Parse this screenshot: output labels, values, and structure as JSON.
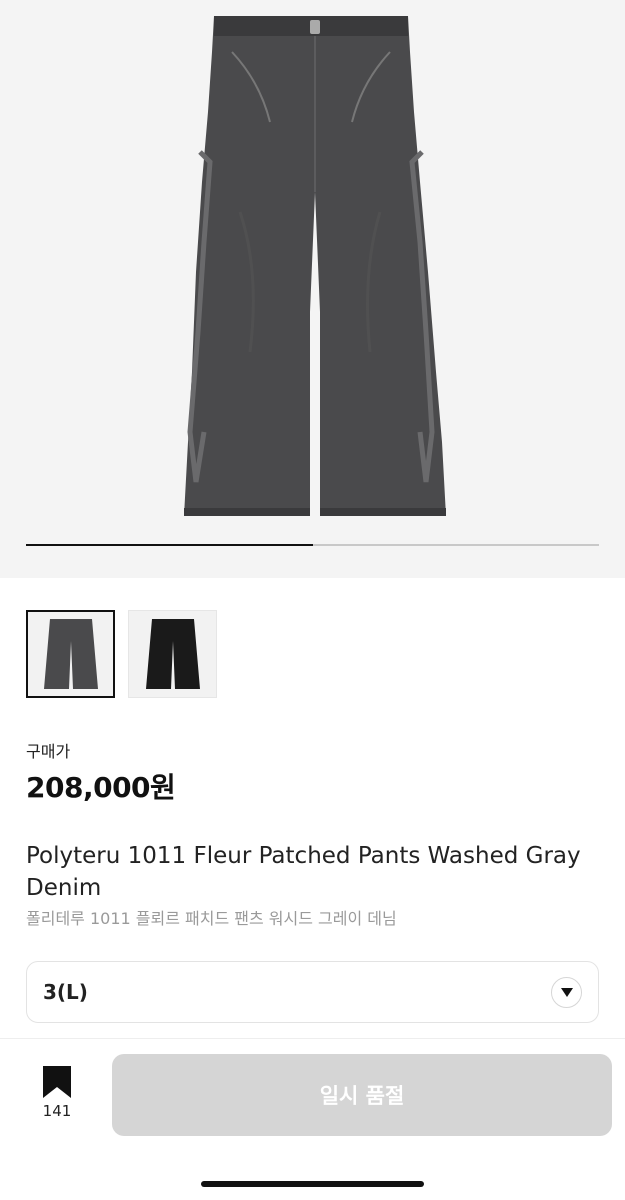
{
  "gallery": {
    "main_image": "gray-washed-denim-pants-photo",
    "progress_fraction": 0.5,
    "thumbnails": [
      {
        "image": "gray-denim-pants-thumbnail",
        "selected": true
      },
      {
        "image": "black-denim-pants-thumbnail",
        "selected": false
      }
    ]
  },
  "product": {
    "price_label": "구매가",
    "price": "208,000원",
    "title_en": "Polyteru 1011 Fleur Patched Pants Washed Gray Denim",
    "title_ko": "폴리테루 1011 플뢰르 패치드 팬츠 워시드 그레이 데님"
  },
  "size_select": {
    "value": "3(L)",
    "icon": "chevron-down-icon"
  },
  "footer": {
    "bookmark_icon": "bookmark-icon",
    "bookmark_count": "141",
    "soldout_label": "일시 품절"
  },
  "colors": {
    "hero_bg": "#f4f4f4",
    "button_disabled": "#d5d5d5",
    "text_secondary": "#9a9a9a"
  }
}
